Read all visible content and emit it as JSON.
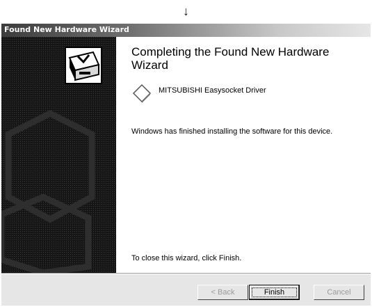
{
  "arrow": "↓",
  "window": {
    "title": "Found New Hardware Wizard"
  },
  "content": {
    "heading": "Completing the Found New Hardware Wizard",
    "device_name": "MITSUBISHI Easysocket Driver",
    "finished_text": "Windows has finished installing the software for this device.",
    "close_hint": "To close this wizard, click Finish."
  },
  "buttons": {
    "back": "< Back",
    "finish": "Finish",
    "cancel": "Cancel"
  },
  "icons": {
    "wizard_banner": "hardware-box-icon",
    "device": "device-diamond-icon"
  }
}
